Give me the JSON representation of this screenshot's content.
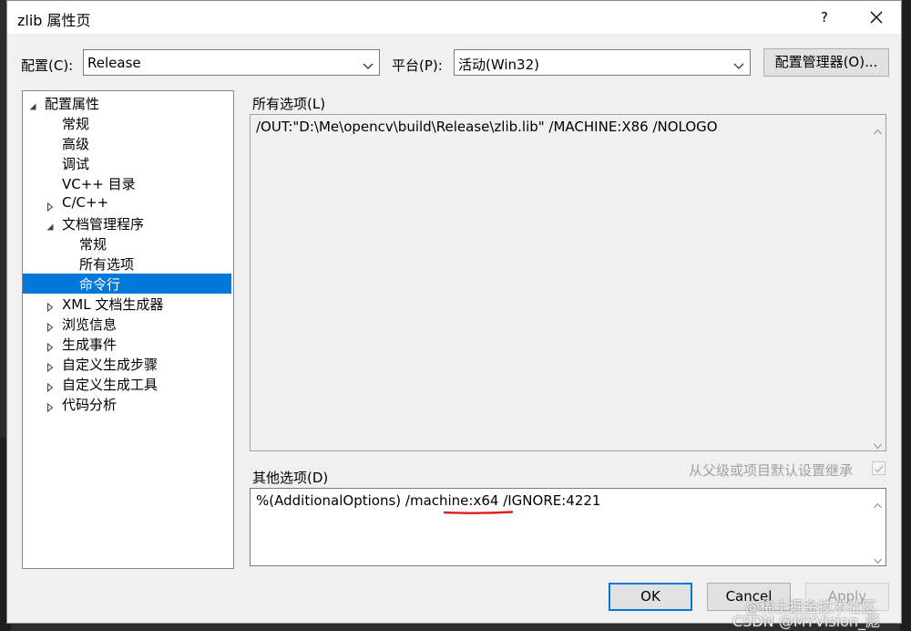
{
  "window": {
    "title": "zlib 属性页",
    "help_label": "?"
  },
  "config": {
    "label": "配置(C):",
    "value": "Release",
    "platform_label": "平台(P):",
    "platform_value": "活动(Win32)",
    "manager_button": "配置管理器(O)..."
  },
  "tree": {
    "items": [
      {
        "label": "配置属性",
        "expander": "expanded"
      },
      {
        "label": "常规",
        "expander": "none"
      },
      {
        "label": "高级",
        "expander": "none"
      },
      {
        "label": "调试",
        "expander": "none"
      },
      {
        "label": "VC++ 目录",
        "expander": "none"
      },
      {
        "label": "C/C++",
        "expander": "collapsed"
      },
      {
        "label": "文档管理程序",
        "expander": "expanded"
      },
      {
        "label": "常规",
        "expander": "none"
      },
      {
        "label": "所有选项",
        "expander": "none"
      },
      {
        "label": "命令行",
        "expander": "none",
        "selected": true
      },
      {
        "label": "XML 文档生成器",
        "expander": "collapsed"
      },
      {
        "label": "浏览信息",
        "expander": "collapsed"
      },
      {
        "label": "生成事件",
        "expander": "collapsed"
      },
      {
        "label": "自定义生成步骤",
        "expander": "collapsed"
      },
      {
        "label": "自定义生成工具",
        "expander": "collapsed"
      },
      {
        "label": "代码分析",
        "expander": "collapsed"
      }
    ]
  },
  "all_options": {
    "label": "所有选项(L)",
    "value": "/OUT:\"D:\\Me\\opencv\\build\\Release\\zlib.lib\" /MACHINE:X86 /NOLOGO"
  },
  "other_options": {
    "label": "其他选项(D)",
    "value": "%(AdditionalOptions) /machine:x64 /IGNORE:4221",
    "inherit_label": "从父级或项目默认设置继承"
  },
  "buttons": {
    "ok": "OK",
    "cancel": "Cancel",
    "apply": "Apply"
  },
  "watermarks": {
    "line1": "@稀土掘金技术社区",
    "line2": "CSDN @MYVision_彪"
  },
  "colors": {
    "selection": "#0078d7",
    "annotation": "#e02020"
  }
}
